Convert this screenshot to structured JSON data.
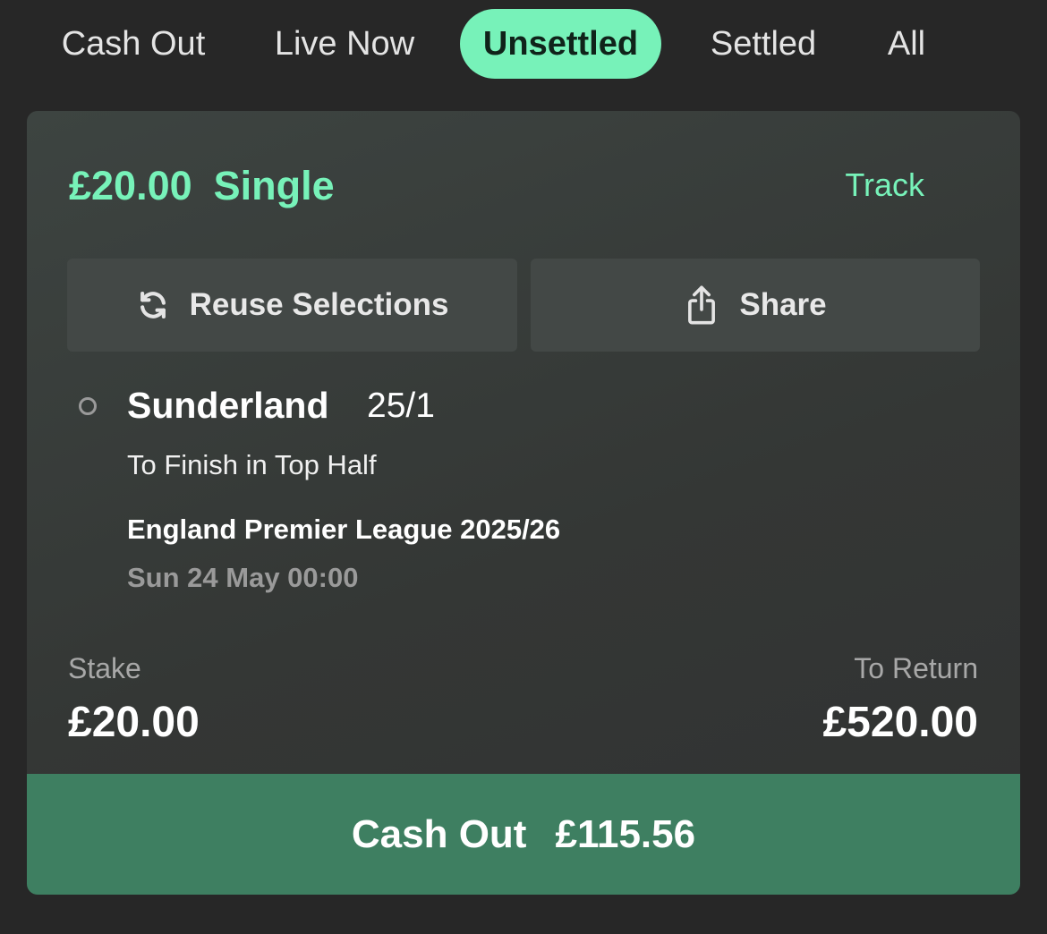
{
  "tabs": [
    {
      "label": "Cash Out"
    },
    {
      "label": "Live Now"
    },
    {
      "label": "Unsettled",
      "active": true
    },
    {
      "label": "Settled"
    },
    {
      "label": "All"
    }
  ],
  "bet": {
    "stake_header": "£20.00",
    "type": "Single",
    "track_label": "Track",
    "reuse_label": "Reuse Selections",
    "reuse_icon": "refresh-icon",
    "share_label": "Share",
    "share_icon": "share-icon",
    "selection": {
      "name": "Sunderland",
      "odds": "25/1",
      "market": "To Finish in Top Half",
      "event": "England Premier League 2025/26",
      "date": "Sun 24 May 00:00"
    },
    "stake_label": "Stake",
    "stake_value": "£20.00",
    "return_label": "To Return",
    "return_value": "£520.00",
    "cashout_label": "Cash Out",
    "cashout_amount": "£115.56"
  },
  "colors": {
    "accent": "#77f2b9",
    "cashout_bg": "#3e7f61",
    "page_bg": "#272727"
  }
}
